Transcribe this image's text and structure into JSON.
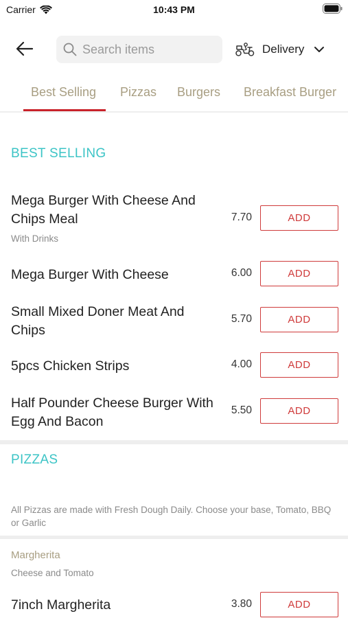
{
  "status_bar": {
    "carrier": "Carrier",
    "time": "10:43 PM"
  },
  "header": {
    "search_placeholder": "Search items",
    "mode_label": "Delivery"
  },
  "tabs": [
    {
      "label": "Best Selling",
      "active": true
    },
    {
      "label": "Pizzas"
    },
    {
      "label": "Burgers"
    },
    {
      "label": "Breakfast Burger"
    }
  ],
  "sections": {
    "best_selling": {
      "title": "BEST SELLING",
      "items": [
        {
          "name": "Mega Burger With Cheese And Chips Meal",
          "subtitle": "With Drinks",
          "price": "7.70",
          "button": "ADD"
        },
        {
          "name": "Mega Burger With Cheese",
          "price": "6.00",
          "button": "ADD"
        },
        {
          "name": "Small Mixed Doner Meat And Chips",
          "price": "5.70",
          "button": "ADD"
        },
        {
          "name": "5pcs Chicken Strips",
          "price": "4.00",
          "button": "ADD"
        },
        {
          "name": "Half Pounder Cheese Burger With Egg And Bacon",
          "price": "5.50",
          "button": "ADD"
        }
      ]
    },
    "pizzas": {
      "title": "PIZZAS",
      "note": "All Pizzas are made with Fresh Dough Daily. Choose your base, Tomato, BBQ or Garlic",
      "group": {
        "title": "Margherita",
        "subtitle": "Cheese and Tomato"
      },
      "items": [
        {
          "name": "7inch Margherita",
          "price": "3.80",
          "button": "ADD"
        }
      ]
    }
  },
  "colors": {
    "accent_red": "#cf3a3a",
    "section_teal": "#3cc4c6",
    "tab_gold": "#a89e82"
  },
  "icons": [
    "wifi-icon",
    "battery-icon",
    "back-arrow-icon",
    "search-icon",
    "scooter-icon",
    "chevron-down-icon"
  ]
}
